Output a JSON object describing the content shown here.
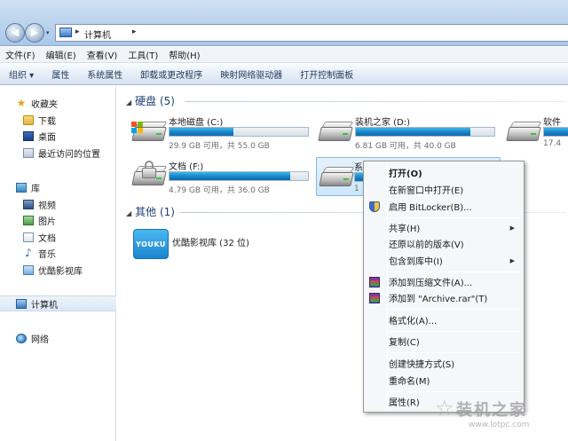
{
  "address": {
    "path": [
      "计算机"
    ]
  },
  "menubar": {
    "items": [
      "文件(F)",
      "编辑(E)",
      "查看(V)",
      "工具(T)",
      "帮助(H)"
    ]
  },
  "toolbar": {
    "organize": "组织 ▾",
    "properties": "属性",
    "system_properties": "系统属性",
    "uninstall": "卸载或更改程序",
    "map_drive": "映射网络驱动器",
    "control_panel": "打开控制面板"
  },
  "sidebar": {
    "favorites": "收藏夹",
    "downloads": "下载",
    "desktop": "桌面",
    "recent": "最近访问的位置",
    "libraries": "库",
    "videos": "视频",
    "pictures": "图片",
    "documents": "文档",
    "music": "音乐",
    "youku": "优酷影视库",
    "computer": "计算机",
    "network": "网络"
  },
  "groups": {
    "hard_disks": "硬盘 (5)",
    "other": "其他 (1)"
  },
  "drives": [
    {
      "name": "本地磁盘 (C:)",
      "info": "29.9 GB 可用，共 55.0 GB",
      "used_fraction": 0.46
    },
    {
      "name": "装机之家 (D:)",
      "info": "6.81 GB 可用，共 40.0 GB",
      "used_fraction": 0.83
    },
    {
      "name": "软件",
      "info": "17.4",
      "used_fraction": 0.5
    },
    {
      "name": "文档 (F:)",
      "info": "4.79 GB 可用，共 36.0 GB",
      "used_fraction": 0.87
    },
    {
      "name": "系统研究 (",
      "info": "1",
      "used_fraction": 0.3
    }
  ],
  "other_items": {
    "youku_logo": "YOUKU",
    "youku_name": "优酷影视库 (32 位)"
  },
  "context_menu": {
    "open": "打开(O)",
    "open_new_window": "在新窗口中打开(E)",
    "bitlocker": "启用 BitLocker(B)...",
    "share": "共享(H)",
    "restore": "还原以前的版本(V)",
    "include_library": "包含到库中(I)",
    "add_archive": "添加到压缩文件(A)...",
    "add_archive_rar": "添加到 \"Archive.rar\"(T)",
    "format": "格式化(A)...",
    "copy": "复制(C)",
    "create_shortcut": "创建快捷方式(S)",
    "rename": "重命名(M)",
    "properties": "属性(R)"
  },
  "watermark": {
    "main": "装机之家",
    "sub": "www.lotpc.com"
  }
}
